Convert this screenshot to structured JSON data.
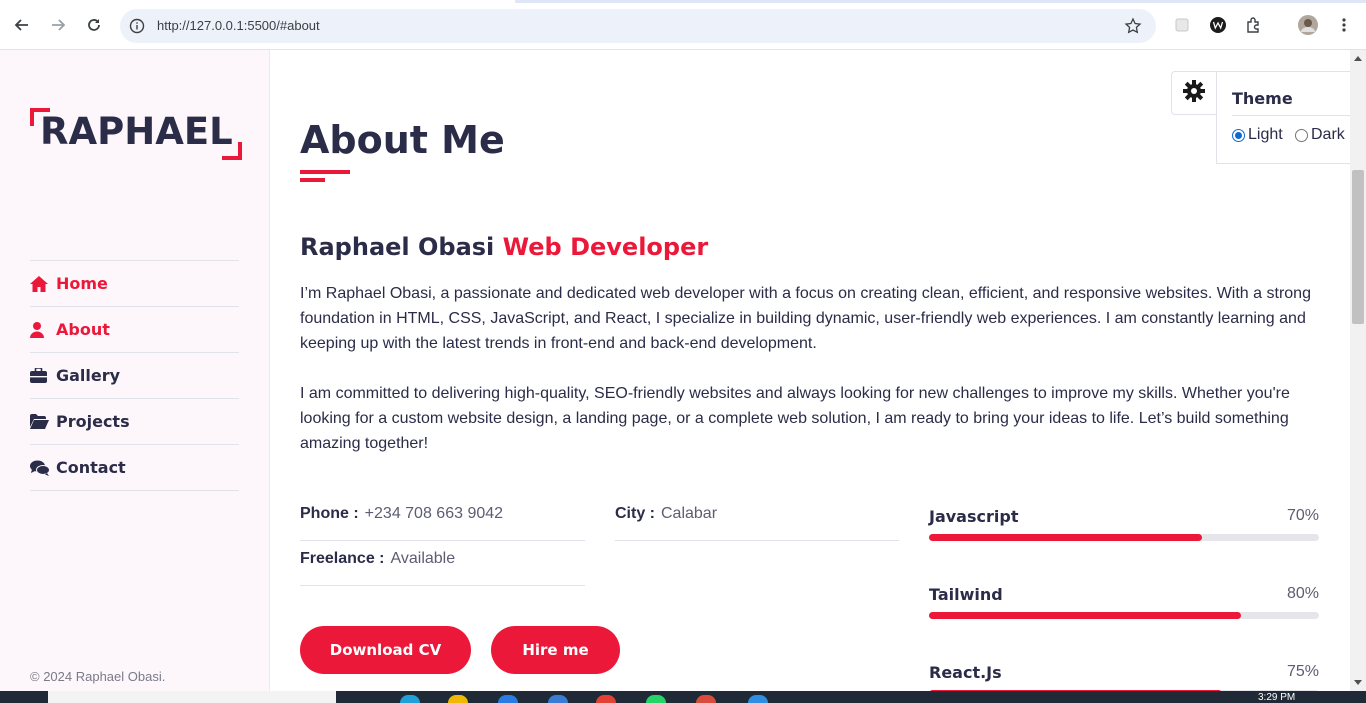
{
  "browser": {
    "url": "http://127.0.0.1:5500/#about",
    "icons": [
      "back-arrow-icon",
      "forward-arrow-icon",
      "reload-icon",
      "site-info-icon",
      "bookmark-star-icon",
      "extension-icon",
      "profile-avatar-icon",
      "menu-kebab-icon"
    ]
  },
  "sidebar": {
    "logo": "RAPHAEL",
    "nav": [
      {
        "label": "Home",
        "icon": "home-icon"
      },
      {
        "label": "About",
        "icon": "user-icon"
      },
      {
        "label": "Gallery",
        "icon": "briefcase-icon"
      },
      {
        "label": "Projects",
        "icon": "folder-open-icon"
      },
      {
        "label": "Contact",
        "icon": "comments-icon"
      }
    ],
    "copyright": "© 2024 Raphael Obasi."
  },
  "about": {
    "title": "About Me",
    "name": "Raphael Obasi",
    "role": "Web Developer",
    "para1": "I’m Raphael Obasi, a passionate and dedicated web developer with a focus on creating clean, efficient, and responsive websites. With a strong foundation in HTML, CSS, JavaScript, and React, I specialize in building dynamic, user-friendly web experiences. I am constantly learning and keeping up with the latest trends in front-end and back-end development.",
    "para2": "I am committed to delivering high-quality, SEO-friendly websites and always looking for new challenges to improve my skills. Whether you're looking for a custom website design, a landing page, or a complete web solution, I am ready to bring your ideas to life. Let’s build something amazing together!",
    "info": {
      "phone_key": "Phone :",
      "phone_val": "+234 708 663 9042",
      "city_key": "City :",
      "city_val": "Calabar",
      "freelance_key": "Freelance :",
      "freelance_val": "Available"
    },
    "buttons": {
      "download": "Download CV",
      "hire": "Hire me"
    },
    "skills": [
      {
        "name": "Javascript",
        "percent_label": "70%",
        "level": 70
      },
      {
        "name": "Tailwind",
        "percent_label": "80%",
        "level": 80
      },
      {
        "name": "React.Js",
        "percent_label": "75%",
        "level": 75
      }
    ]
  },
  "theme": {
    "title": "Theme",
    "options": [
      {
        "label": "Light",
        "checked": true
      },
      {
        "label": "Dark",
        "checked": false
      }
    ]
  },
  "taskbar": {
    "clock": "3:29 PM"
  },
  "colors": {
    "accent": "#ec1839",
    "text": "#2b2c48",
    "sidebar_bg": "#fdf7fc"
  }
}
